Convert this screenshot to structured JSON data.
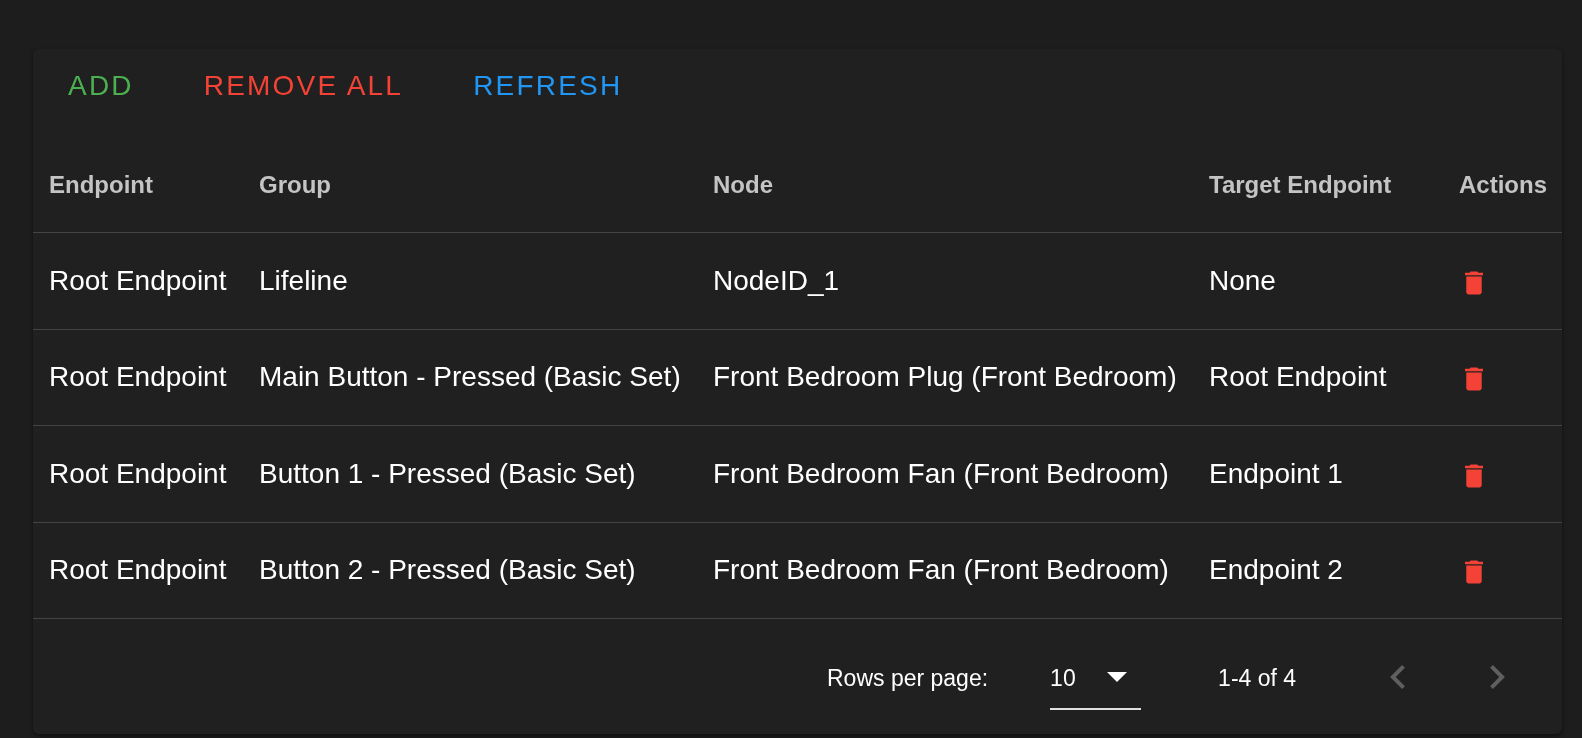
{
  "toolbar": {
    "buttons": [
      {
        "label": "ADD",
        "color": "#4caf50"
      },
      {
        "label": "REMOVE ALL",
        "color": "#f44336"
      },
      {
        "label": "REFRESH",
        "color": "#2196f3"
      }
    ]
  },
  "table": {
    "columns": [
      "Endpoint",
      "Group",
      "Node",
      "Target Endpoint",
      "Actions"
    ],
    "rows": [
      {
        "endpoint": "Root Endpoint",
        "group": "Lifeline",
        "node": "NodeID_1",
        "target_endpoint": "None"
      },
      {
        "endpoint": "Root Endpoint",
        "group": "Main Button - Pressed (Basic Set)",
        "node": "Front Bedroom Plug (Front Bedroom)",
        "target_endpoint": "Root Endpoint"
      },
      {
        "endpoint": "Root Endpoint",
        "group": "Button 1 - Pressed (Basic Set)",
        "node": "Front Bedroom Fan (Front Bedroom)",
        "target_endpoint": "Endpoint 1"
      },
      {
        "endpoint": "Root Endpoint",
        "group": "Button 2 - Pressed (Basic Set)",
        "node": "Front Bedroom Fan (Front Bedroom)",
        "target_endpoint": "Endpoint 2"
      }
    ]
  },
  "pagination": {
    "rows_per_page_label": "Rows per page:",
    "rows_per_page": "10",
    "range": "1-4 of 4",
    "previous": {
      "disabled": true
    },
    "next": {
      "disabled": true
    }
  }
}
